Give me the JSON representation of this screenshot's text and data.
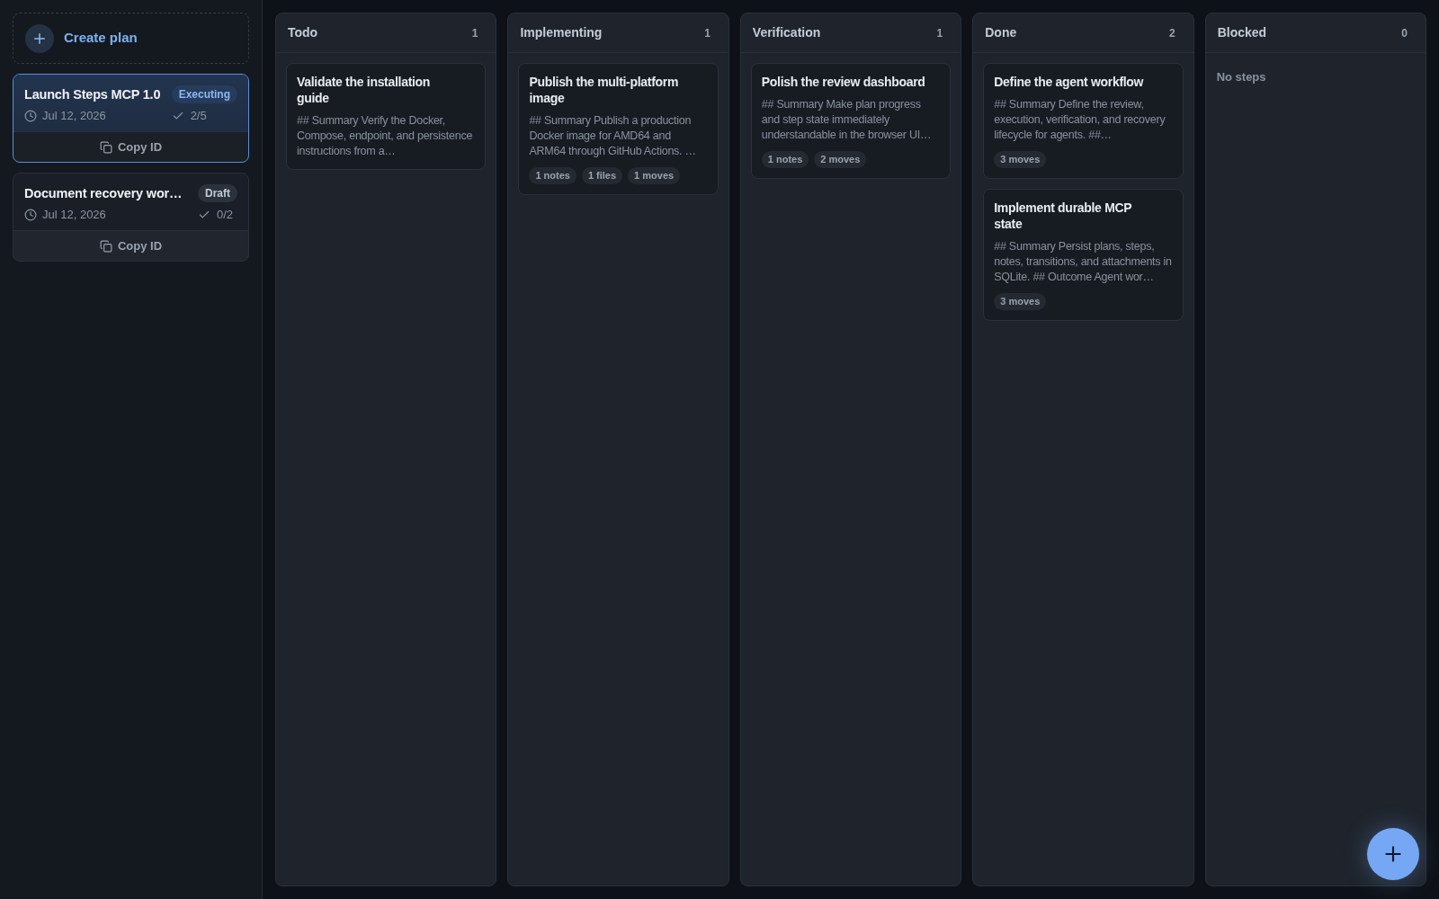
{
  "sidebar": {
    "create_button": "Create plan",
    "plans": [
      {
        "title": "Launch Steps MCP 1.0",
        "status": {
          "label": "Executing",
          "kind": "executing"
        },
        "date": "Jul 12, 2026",
        "progress": "2/5",
        "copy_button": "Copy ID",
        "selected": true
      },
      {
        "title": "Document recovery wor…",
        "status": {
          "label": "Draft",
          "kind": "draft"
        },
        "date": "Jul 12, 2026",
        "progress": "0/2",
        "copy_button": "Copy ID",
        "selected": false
      }
    ]
  },
  "board": {
    "columns": [
      {
        "title": "Todo",
        "count": "1",
        "cards": [
          {
            "title": "Validate the installation guide",
            "summary": "## Summary Verify the Docker, Compose, endpoint, and persistence instructions from a…"
          }
        ]
      },
      {
        "title": "Implementing",
        "count": "1",
        "cards": [
          {
            "title": "Publish the multi-platform image",
            "summary": "## Summary Publish a production Docker image for AMD64 and ARM64 through GitHub Actions. …",
            "tags": [
              "1 notes",
              "1 files",
              "1 moves"
            ]
          }
        ]
      },
      {
        "title": "Verification",
        "count": "1",
        "cards": [
          {
            "title": "Polish the review dashboard",
            "summary": "## Summary Make plan progress and step state immediately understandable in the browser UI…",
            "tags": [
              "1 notes",
              "2 moves"
            ]
          }
        ]
      },
      {
        "title": "Done",
        "count": "2",
        "cards": [
          {
            "title": "Define the agent workflow",
            "summary": "## Summary Define the review, execution, verification, and recovery lifecycle for agents. ##…",
            "tags": [
              "3 moves"
            ]
          },
          {
            "title": "Implement durable MCP state",
            "summary": "## Summary Persist plans, steps, notes, transitions, and attachments in SQLite. ## Outcome Agent wor…",
            "tags": [
              "3 moves"
            ]
          }
        ]
      },
      {
        "title": "Blocked",
        "count": "0",
        "empty_text": "No steps"
      }
    ]
  }
}
